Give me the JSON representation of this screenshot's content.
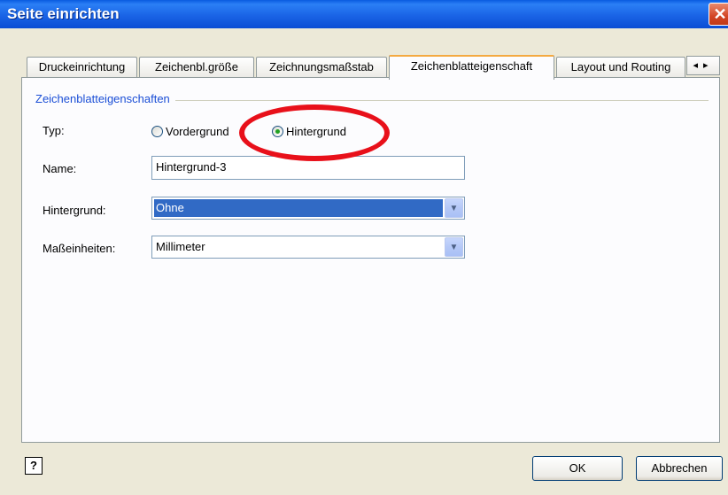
{
  "window": {
    "title": "Seite einrichten",
    "close_glyph": "✕"
  },
  "tabs": [
    {
      "label": "Druckeinrichtung"
    },
    {
      "label": "Zeichenbl.größe"
    },
    {
      "label": "Zeichnungsmaßstab"
    },
    {
      "label": "Zeichenblatteigenschaft",
      "active": true
    },
    {
      "label": "Layout und Routing"
    }
  ],
  "tab_scroll": {
    "left": "◂",
    "right": "▸"
  },
  "group": {
    "title": "Zeichenblatteigenschaften"
  },
  "form": {
    "typ_label": "Typ:",
    "radio_vordergrund": "Vordergrund",
    "radio_hintergrund": "Hintergrund",
    "selected_type": "Hintergrund",
    "name_label": "Name:",
    "name_value": "Hintergrund-3",
    "hintergrund_label": "Hintergrund:",
    "hintergrund_value": "Ohne",
    "masseinheiten_label": "Maßeinheiten:",
    "masseinheiten_value": "Millimeter"
  },
  "footer": {
    "help_glyph": "?",
    "ok": "OK",
    "cancel": "Abbrechen"
  },
  "annotation": {
    "color": "#e8101a"
  },
  "colors": {
    "titlebar": "#0a5be0",
    "selection": "#316ac5",
    "group_title": "#1a4ed6"
  }
}
